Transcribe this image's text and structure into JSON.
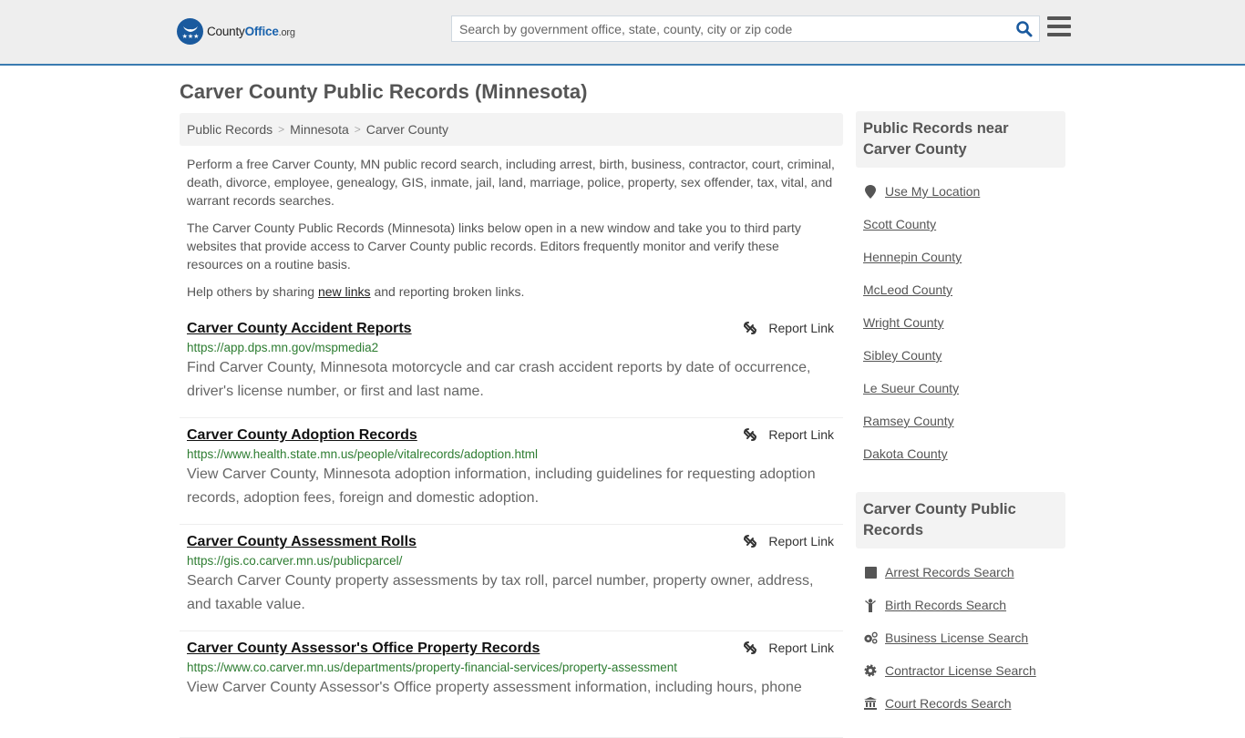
{
  "header": {
    "logo": {
      "name_part1": "County",
      "name_part2": "Office",
      "name_part3": ".org"
    },
    "search": {
      "placeholder": "Search by government office, state, county, city or zip code",
      "value": ""
    },
    "colors": {
      "accent": "#3a7bb0",
      "brand": "#1a5a9e"
    }
  },
  "page": {
    "title": "Carver County Public Records (Minnesota)"
  },
  "breadcrumb": [
    {
      "label": "Public Records"
    },
    {
      "label": "Minnesota"
    },
    {
      "label": "Carver County"
    }
  ],
  "intro": {
    "p1": "Perform a free Carver County, MN public record search, including arrest, birth, business, contractor, court, criminal, death, divorce, employee, genealogy, GIS, inmate, jail, land, marriage, police, property, sex offender, tax, vital, and warrant records searches.",
    "p2": "The Carver County Public Records (Minnesota) links below open in a new window and take you to third party websites that provide access to Carver County public records. Editors frequently monitor and verify these resources on a routine basis.",
    "p3_before": "Help others by sharing ",
    "p3_link": "new links",
    "p3_after": " and reporting broken links."
  },
  "report_label": "Report Link",
  "records": [
    {
      "title": "Carver County Accident Reports",
      "url": "https://app.dps.mn.gov/mspmedia2",
      "description": "Find Carver County, Minnesota motorcycle and car crash accident reports by date of occurrence, driver's license number, or first and last name."
    },
    {
      "title": "Carver County Adoption Records",
      "url": "https://www.health.state.mn.us/people/vitalrecords/adoption.html",
      "description": "View Carver County, Minnesota adoption information, including guidelines for requesting adoption records, adoption fees, foreign and domestic adoption."
    },
    {
      "title": "Carver County Assessment Rolls",
      "url": "https://gis.co.carver.mn.us/publicparcel/",
      "description": "Search Carver County property assessments by tax roll, parcel number, property owner, address, and taxable value."
    },
    {
      "title": "Carver County Assessor's Office Property Records",
      "url": "https://www.co.carver.mn.us/departments/property-financial-services/property-assessment",
      "description": "View Carver County Assessor's Office property assessment information, including hours, phone"
    }
  ],
  "sidebar": {
    "nearby_title": "Public Records near Carver County",
    "use_location": "Use My Location",
    "nearby": [
      "Scott County",
      "Hennepin County",
      "McLeod County",
      "Wright County",
      "Sibley County",
      "Le Sueur County",
      "Ramsey County",
      "Dakota County"
    ],
    "records_title": "Carver County Public Records",
    "record_links": [
      {
        "label": "Arrest Records Search",
        "icon": "square-icon"
      },
      {
        "label": "Birth Records Search",
        "icon": "child-icon"
      },
      {
        "label": "Business License Search",
        "icon": "cogs-icon"
      },
      {
        "label": "Contractor License Search",
        "icon": "cog-icon"
      },
      {
        "label": "Court Records Search",
        "icon": "courthouse-icon"
      }
    ]
  }
}
